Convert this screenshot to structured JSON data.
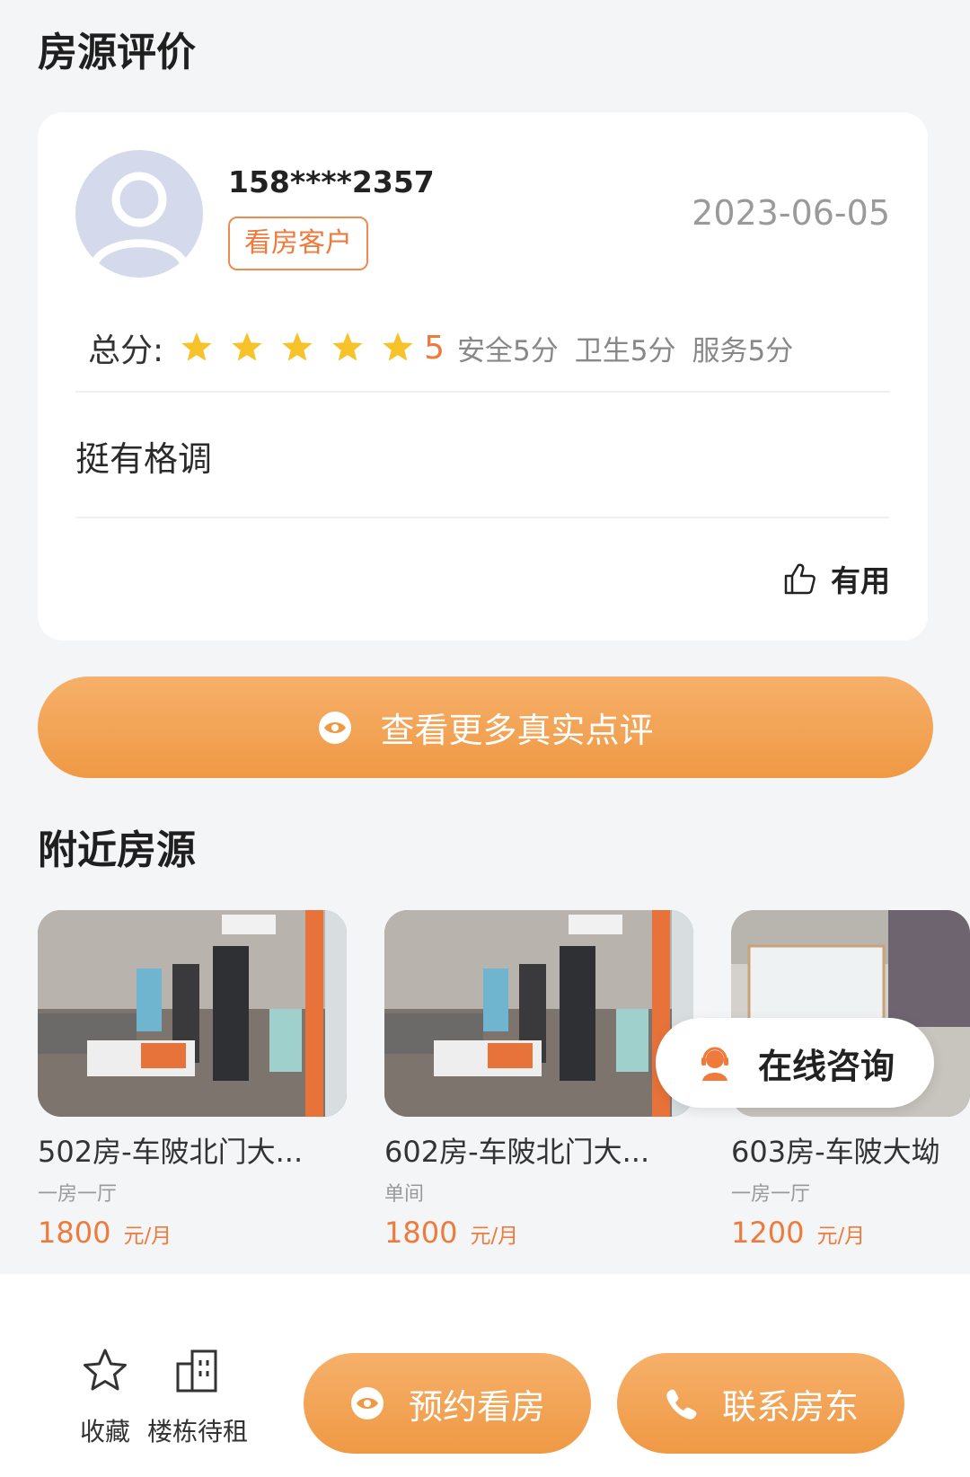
{
  "review_section": {
    "title": "房源评价",
    "review": {
      "reviewer": "158****2357",
      "badge": "看房客户",
      "date": "2023-06-05",
      "score_label": "总分:",
      "stars": 5,
      "score": "5",
      "sub_scores": [
        "安全5分",
        "卫生5分",
        "服务5分"
      ],
      "text": "挺有格调",
      "useful_label": "有用"
    },
    "more_label": "查看更多真实点评"
  },
  "nearby_section": {
    "title": "附近房源",
    "listings": [
      {
        "title": "502房-车陂北门大...",
        "type": "一房一厅",
        "price": "1800",
        "unit": "元/月"
      },
      {
        "title": "602房-车陂北门大...",
        "type": "单间",
        "price": "1800",
        "unit": "元/月"
      },
      {
        "title": "603房-车陂大坳",
        "type": "一房一厅",
        "price": "1200",
        "unit": "元/月"
      }
    ],
    "consult_label": "在线咨询"
  },
  "bottom_bar": {
    "favorite_label": "收藏",
    "building_label": "楼栋待租",
    "appointment_label": "预约看房",
    "contact_label": "联系房东"
  },
  "colors": {
    "accent": "#ef9944",
    "accent_light": "#f6b06a",
    "price": "#ee7a3c",
    "star": "#f7c22a"
  }
}
